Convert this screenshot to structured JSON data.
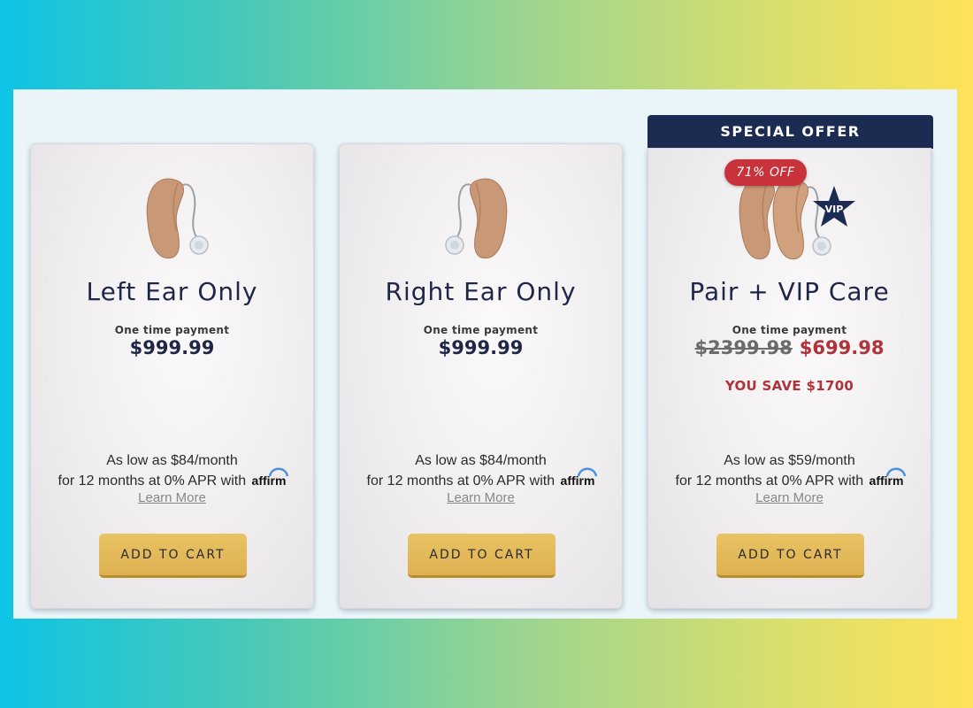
{
  "colors": {
    "navy": "#1c2b52",
    "title": "#1f2748",
    "sale_red": "#b0323b",
    "button_gold": "#e3b95a",
    "panel": "#eaf5fa"
  },
  "special_offer_label": "SPECIAL OFFER",
  "cards": [
    {
      "title": "Left Ear Only",
      "payment_label": "One time payment",
      "price": "$999.99",
      "financing_line1": "As low as $84/month",
      "financing_line2": "for 12 months at 0% APR with",
      "affirm_label": "affirm",
      "learn_more": "Learn More",
      "cta": "ADD TO CART",
      "image_icon": "hearing-aid-left-icon"
    },
    {
      "title": "Right Ear Only",
      "payment_label": "One time payment",
      "price": "$999.99",
      "financing_line1": "As low as $84/month",
      "financing_line2": "for 12 months at 0% APR with",
      "affirm_label": "affirm",
      "learn_more": "Learn More",
      "cta": "ADD TO CART",
      "image_icon": "hearing-aid-right-icon"
    },
    {
      "title": "Pair + VIP Care",
      "payment_label": "One time payment",
      "price_old": "$2399.98",
      "price_new": "$699.98",
      "savings": "YOU SAVE $1700",
      "discount_badge": "71% OFF",
      "vip_badge": "VIP",
      "financing_line1": "As low as $59/month",
      "financing_line2": "for 12 months at 0% APR with",
      "affirm_label": "affirm",
      "learn_more": "Learn More",
      "cta": "ADD TO CART",
      "image_icon": "hearing-aid-pair-icon"
    }
  ]
}
